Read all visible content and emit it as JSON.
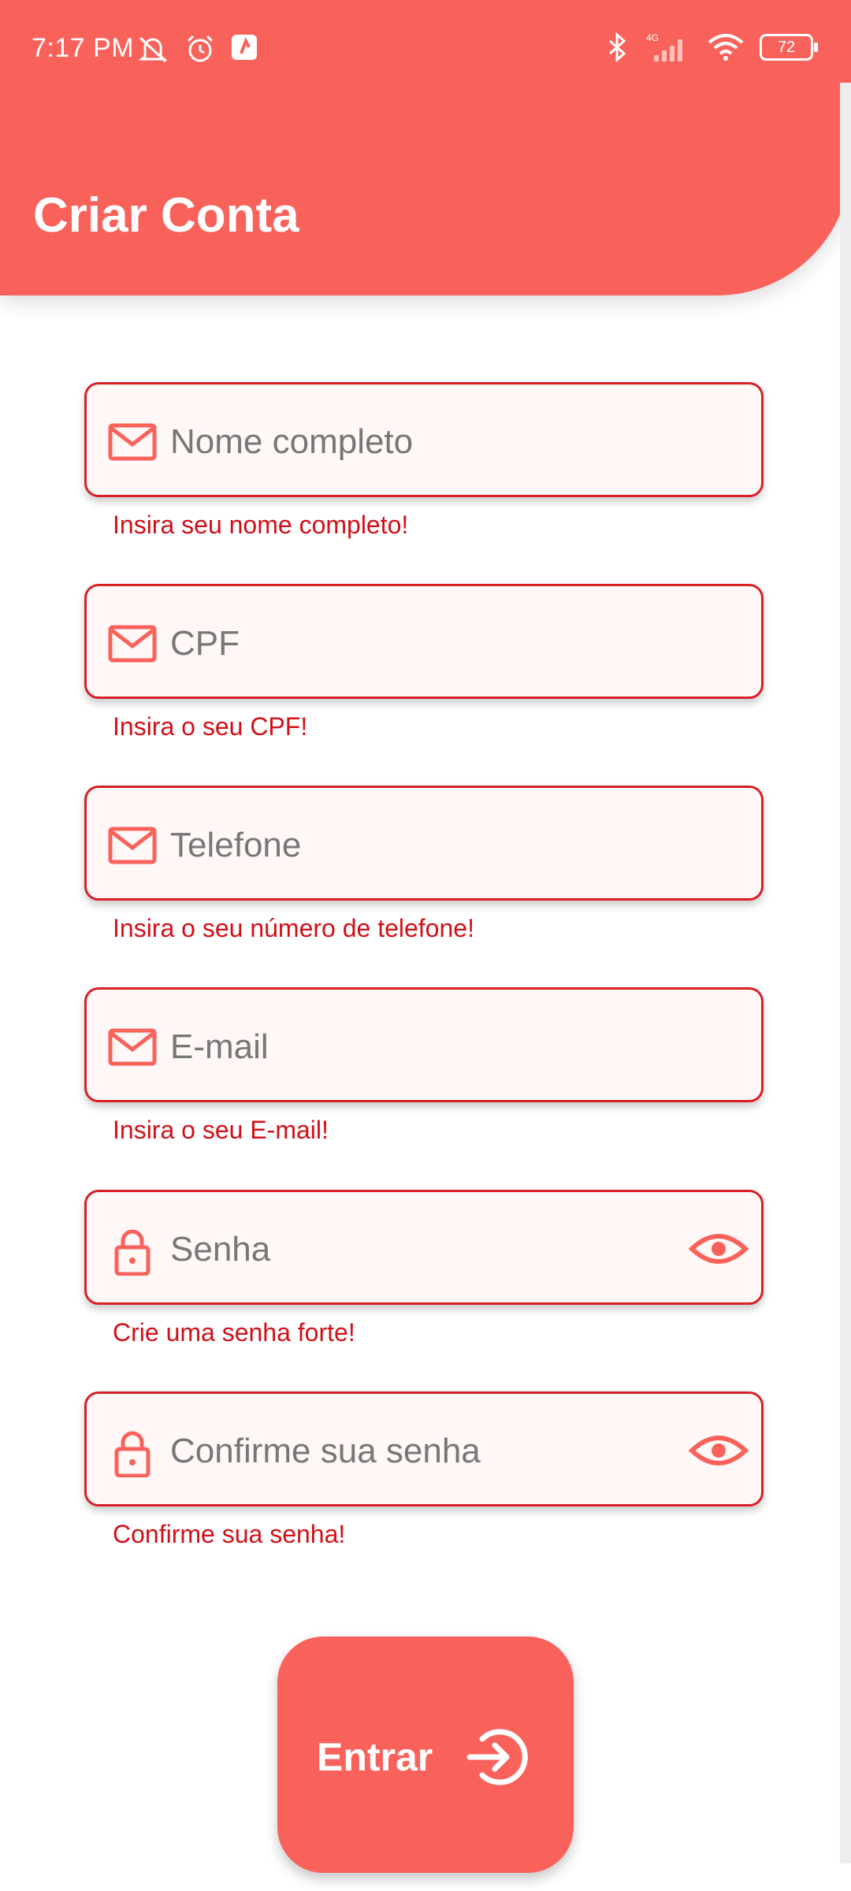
{
  "status": {
    "time": "7:17 PM",
    "battery": "72",
    "network": "4G"
  },
  "header": {
    "title": "Criar Conta"
  },
  "colors": {
    "accent": "#f9625b",
    "error": "#d20f17",
    "field_border": "#d81f26"
  },
  "fields": [
    {
      "icon": "mail-icon",
      "placeholder": "Nome completo",
      "error": "Insira seu nome completo!"
    },
    {
      "icon": "mail-icon",
      "placeholder": "CPF",
      "error": "Insira o seu CPF!"
    },
    {
      "icon": "mail-icon",
      "placeholder": "Telefone",
      "error": "Insira o seu número de telefone!"
    },
    {
      "icon": "mail-icon",
      "placeholder": "E-mail",
      "error": "Insira o seu E-mail!"
    },
    {
      "icon": "lock-icon",
      "placeholder": "Senha",
      "error": "Crie uma senha forte!",
      "trailing_icon": "eye-icon"
    },
    {
      "icon": "lock-icon",
      "placeholder": "Confirme sua senha",
      "error": "Confirme sua senha!",
      "trailing_icon": "eye-icon"
    }
  ],
  "submit": {
    "label": "Entrar",
    "icon": "login-icon"
  }
}
